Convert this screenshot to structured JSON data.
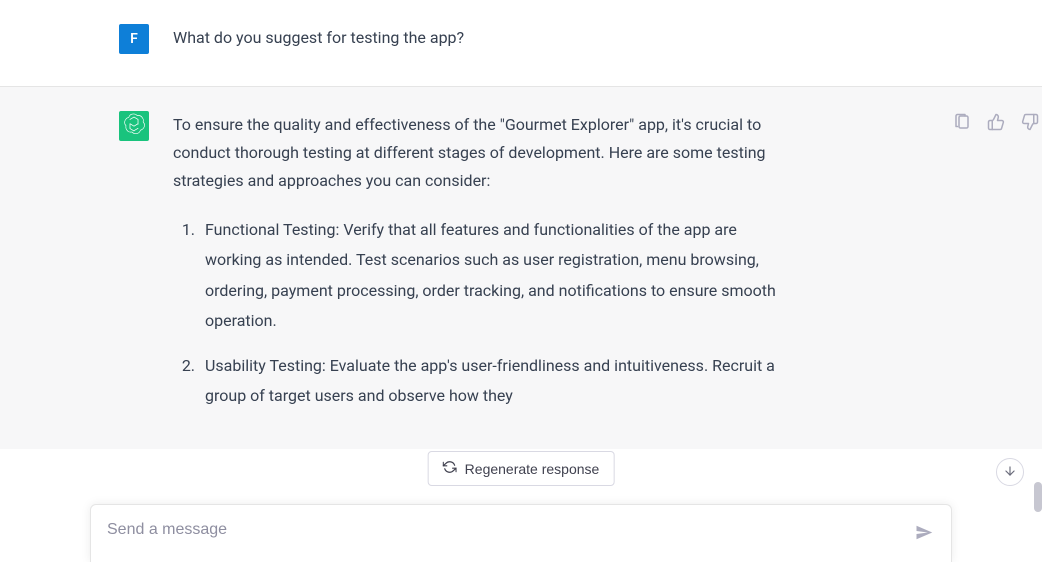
{
  "user": {
    "avatar_letter": "F",
    "message": "What do you suggest for testing the app?"
  },
  "assistant": {
    "intro": "To ensure the quality and effectiveness of the \"Gourmet Explorer\" app, it's crucial to conduct thorough testing at different stages of development. Here are some testing strategies and approaches you can consider:",
    "items": [
      "Functional Testing: Verify that all features and functionalities of the app are working as intended. Test scenarios such as user registration, menu browsing, ordering, payment processing, order tracking, and notifications to ensure smooth operation.",
      "Usability Testing: Evaluate the app's user-friendliness and intuitiveness. Recruit a group of target users and observe how they"
    ]
  },
  "regenerate_label": "Regenerate response",
  "input_placeholder": "Send a message"
}
